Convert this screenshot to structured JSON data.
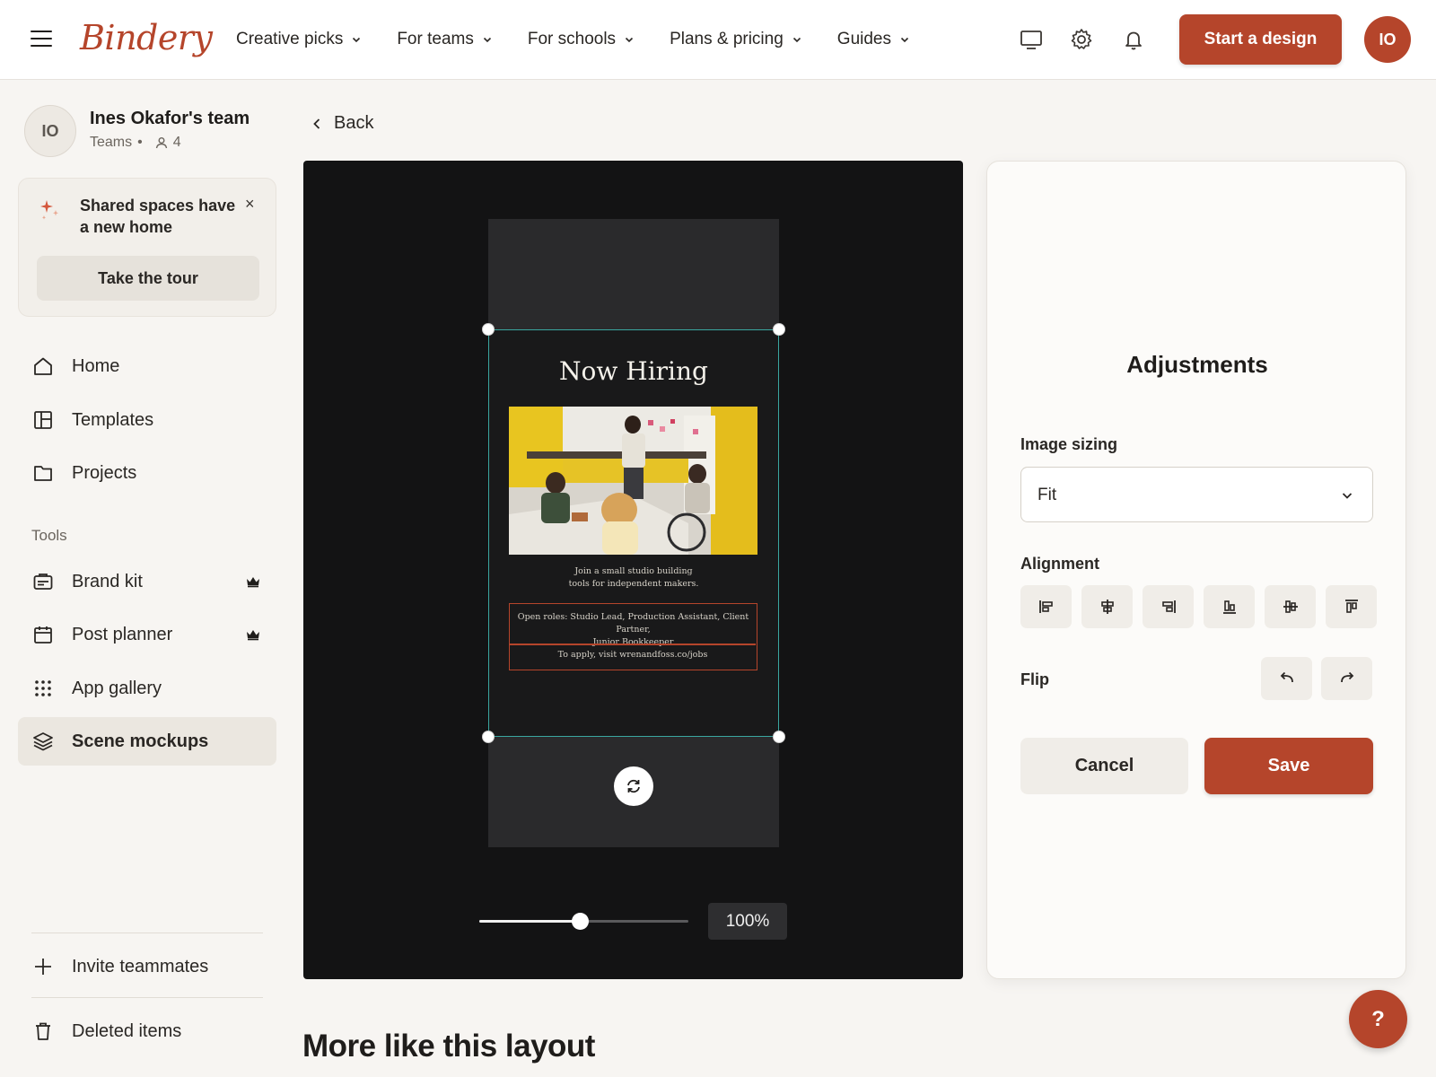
{
  "brand": {
    "name": "Bindery",
    "accent": "#b5452b"
  },
  "nav": [
    {
      "label": "Creative picks"
    },
    {
      "label": "For teams"
    },
    {
      "label": "For schools"
    },
    {
      "label": "Plans & pricing"
    },
    {
      "label": "Guides"
    }
  ],
  "header": {
    "icons": [
      "monitor-icon",
      "gear-icon",
      "bell-icon"
    ],
    "cta_label": "Start a design",
    "user_initials": "IO"
  },
  "sidebar": {
    "team": {
      "initials": "IO",
      "name": "Ines Okafor's team",
      "type": "Teams",
      "member_count": "4"
    },
    "promo": {
      "text": "Shared spaces have a new home",
      "close": "×",
      "button": "Take the tour"
    },
    "main_items": [
      {
        "label": "Home",
        "icon": "home-icon"
      },
      {
        "label": "Templates",
        "icon": "templates-icon"
      },
      {
        "label": "Projects",
        "icon": "folder-icon"
      }
    ],
    "tools_label": "Tools",
    "tool_items": [
      {
        "label": "Brand kit",
        "icon": "brand-kit-icon",
        "premium": true
      },
      {
        "label": "Post planner",
        "icon": "calendar-icon",
        "premium": true
      },
      {
        "label": "App gallery",
        "icon": "grid-icon",
        "premium": false
      },
      {
        "label": "Scene mockups",
        "icon": "layers-icon",
        "premium": false,
        "active": true
      }
    ],
    "footer_items": [
      {
        "label": "Invite teammates",
        "icon": "plus-icon"
      },
      {
        "label": "Deleted items",
        "icon": "trash-icon"
      }
    ]
  },
  "back_label": "Back",
  "canvas": {
    "poster": {
      "title": "Now Hiring",
      "subtitle_line1": "Join a small studio building",
      "subtitle_line2": "tools for independent makers.",
      "roles_line1": "Open roles: Studio Lead, Production Assistant, Client Partner,",
      "roles_line2": "Junior Bookkeeper",
      "apply": "To apply, visit wrenandfoss.co/jobs"
    },
    "zoom": {
      "value": 0.48,
      "label": "100%"
    }
  },
  "adjustments": {
    "title": "Adjustments",
    "image_sizing_label": "Image sizing",
    "image_sizing_value": "Fit",
    "alignment_label": "Alignment",
    "alignment_options": [
      "align-left-icon",
      "align-center-h-icon",
      "align-right-icon",
      "align-bottom-icon",
      "align-middle-v-icon",
      "align-top-icon"
    ],
    "flip_label": "Flip",
    "flip_options": [
      "flip-left-icon",
      "flip-right-icon"
    ],
    "cancel_label": "Cancel",
    "save_label": "Save"
  },
  "help_label": "?",
  "more_heading": "More like this layout"
}
